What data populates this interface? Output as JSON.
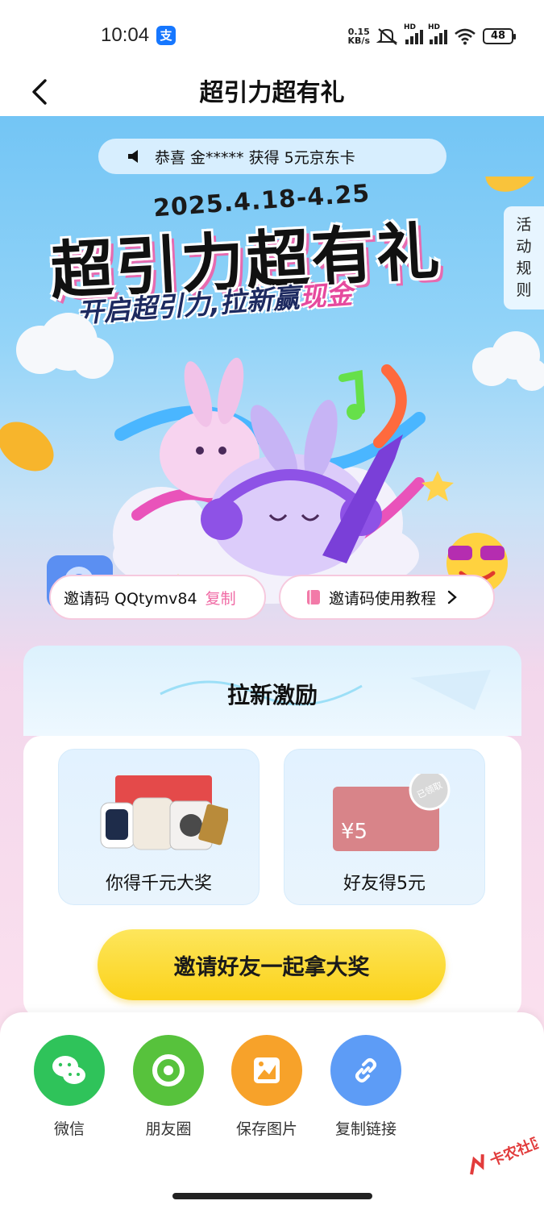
{
  "status_bar": {
    "time": "10:04",
    "app_badge": "支",
    "net_speed_value": "0.15",
    "net_speed_unit": "KB/s",
    "signal_hd_1": "HD",
    "signal_hd_2": "HD",
    "battery": "48"
  },
  "nav": {
    "title": "超引力超有礼"
  },
  "hero": {
    "ticker": "恭喜 金***** 获得 5元京东卡",
    "date_range": "2025.4.18-4.25",
    "title": "超引力超有礼",
    "subtitle_prefix": "开启超引力,拉新赢",
    "subtitle_highlight": "现金",
    "rules_tab": [
      "活",
      "动",
      "规",
      "则"
    ]
  },
  "invite": {
    "code_text": "邀请码 QQtymv84",
    "copy_label": "复制",
    "tutorial_label": "邀请码使用教程"
  },
  "incentive": {
    "title": "拉新激励",
    "rewards": [
      {
        "label": "你得千元大奖"
      },
      {
        "label": "好友得5元",
        "card_value": "¥5",
        "stamp": "已领取"
      }
    ],
    "cta_label": "邀请好友一起拿大奖"
  },
  "share": {
    "items": [
      {
        "label": "微信",
        "icon": "wechat-icon",
        "color": "#2fc35a"
      },
      {
        "label": "朋友圈",
        "icon": "moments-icon",
        "color": "#57c23c"
      },
      {
        "label": "保存图片",
        "icon": "image-icon",
        "color": "#f7a22a"
      },
      {
        "label": "复制链接",
        "icon": "link-icon",
        "color": "#5d9cf6"
      }
    ]
  },
  "watermark": "卡农社区"
}
